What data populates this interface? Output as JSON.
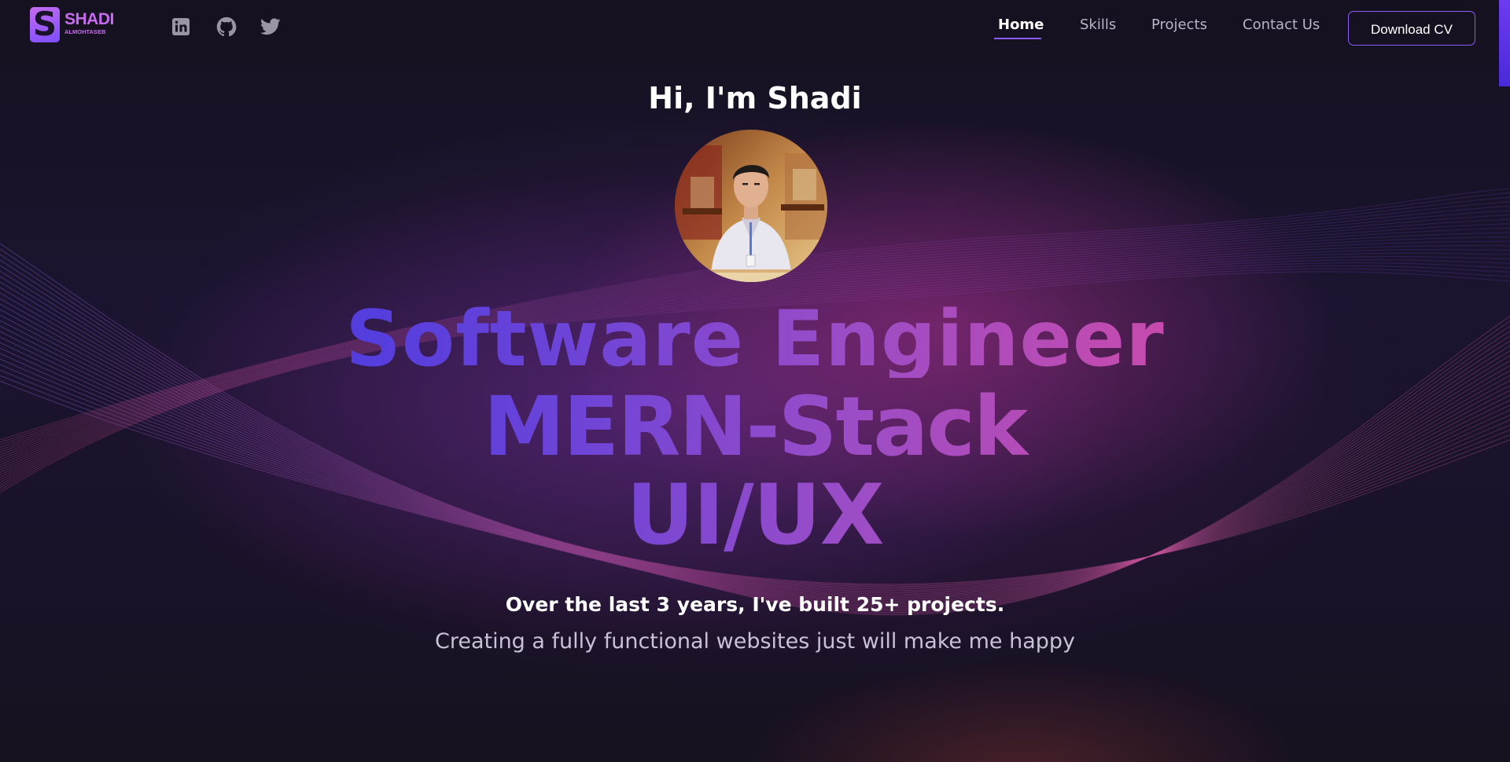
{
  "brand": {
    "badge_letter": "S",
    "name": "SHADI",
    "subtitle": "ALMOHTASEB"
  },
  "social": [
    {
      "icon": "linkedin-icon"
    },
    {
      "icon": "github-icon"
    },
    {
      "icon": "twitter-icon"
    }
  ],
  "nav": {
    "items": [
      {
        "label": "Home",
        "active": true
      },
      {
        "label": "Skills",
        "active": false
      },
      {
        "label": "Projects",
        "active": false
      },
      {
        "label": "Contact Us",
        "active": false
      }
    ],
    "cta_label": "Download CV"
  },
  "hero": {
    "greeting": "Hi, I'm Shadi",
    "roles": [
      "Software Engineer",
      "MERN-Stack",
      "UI/UX"
    ],
    "tagline": "Over the last 3 years, I've built 25+ projects.",
    "subline": "Creating a fully functional websites just will make me happy"
  },
  "colors": {
    "background": "#14101f",
    "accent": "#8b5cf6",
    "gradient_start": "#4a3be0",
    "gradient_end": "#d04aa8",
    "brand": "#c86bf0"
  }
}
